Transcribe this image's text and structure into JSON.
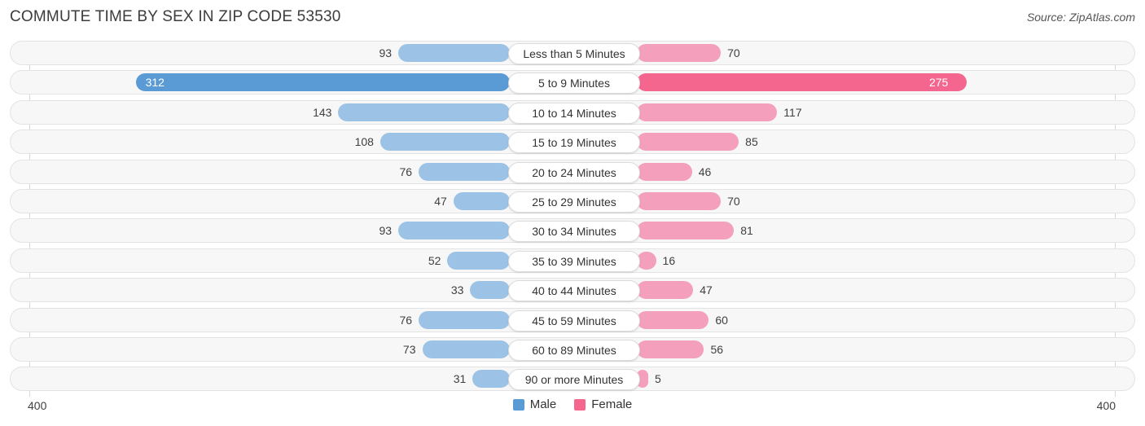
{
  "header": {
    "title": "COMMUTE TIME BY SEX IN ZIP CODE 53530",
    "source": "Source: ZipAtlas.com"
  },
  "axis": {
    "left_max_label": "400",
    "right_max_label": "400"
  },
  "legend": {
    "male_label": "Male",
    "female_label": "Female",
    "male_color": "#5b9bd5",
    "female_color": "#f4668e"
  },
  "colors": {
    "male_light": "#9cc3e5",
    "male_peak": "#5b9bd5",
    "female_light": "#f4a0bd",
    "female_peak": "#f4668e",
    "track": "#f7f7f7",
    "track_border": "#e3e3e3"
  },
  "chart_data": {
    "type": "bar",
    "orientation": "horizontal-diverging",
    "title": "COMMUTE TIME BY SEX IN ZIP CODE 53530",
    "xlabel": "",
    "ylabel": "",
    "xlim": [
      400,
      400
    ],
    "grid": false,
    "legend_position": "bottom-center",
    "categories": [
      "Less than 5 Minutes",
      "5 to 9 Minutes",
      "10 to 14 Minutes",
      "15 to 19 Minutes",
      "20 to 24 Minutes",
      "25 to 29 Minutes",
      "30 to 34 Minutes",
      "35 to 39 Minutes",
      "40 to 44 Minutes",
      "45 to 59 Minutes",
      "60 to 89 Minutes",
      "90 or more Minutes"
    ],
    "series": [
      {
        "name": "Male",
        "side": "left",
        "values": [
          93,
          312,
          143,
          108,
          76,
          47,
          93,
          52,
          33,
          76,
          73,
          31
        ]
      },
      {
        "name": "Female",
        "side": "right",
        "values": [
          70,
          275,
          117,
          85,
          46,
          70,
          81,
          16,
          47,
          60,
          56,
          5
        ]
      }
    ]
  }
}
